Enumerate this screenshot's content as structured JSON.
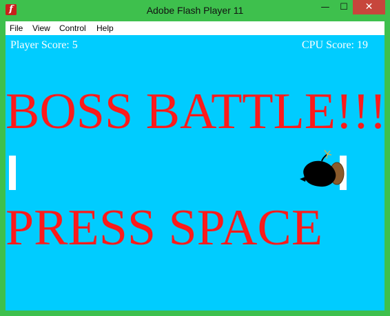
{
  "window": {
    "title": "Adobe Flash Player 11",
    "app_icon_glyph": "f",
    "controls": {
      "minimize": "—",
      "maximize": "☐",
      "close": "✕"
    }
  },
  "menu": [
    "File",
    "View",
    "Control",
    "Help"
  ],
  "game": {
    "player_score": "Player Score: 5",
    "cpu_score": "CPU Score: 19",
    "headline": "BOSS BATTLE!!!",
    "prompt": "PRESS SPACE"
  },
  "colors": {
    "frame": "#3ec04d",
    "stage_bg": "#00ccff",
    "headline": "#ff1a1a",
    "score_text": "#ffffff",
    "paddle": "#ffffff"
  },
  "icons": {
    "app": "flash-icon",
    "boss": "bomb-icon"
  }
}
